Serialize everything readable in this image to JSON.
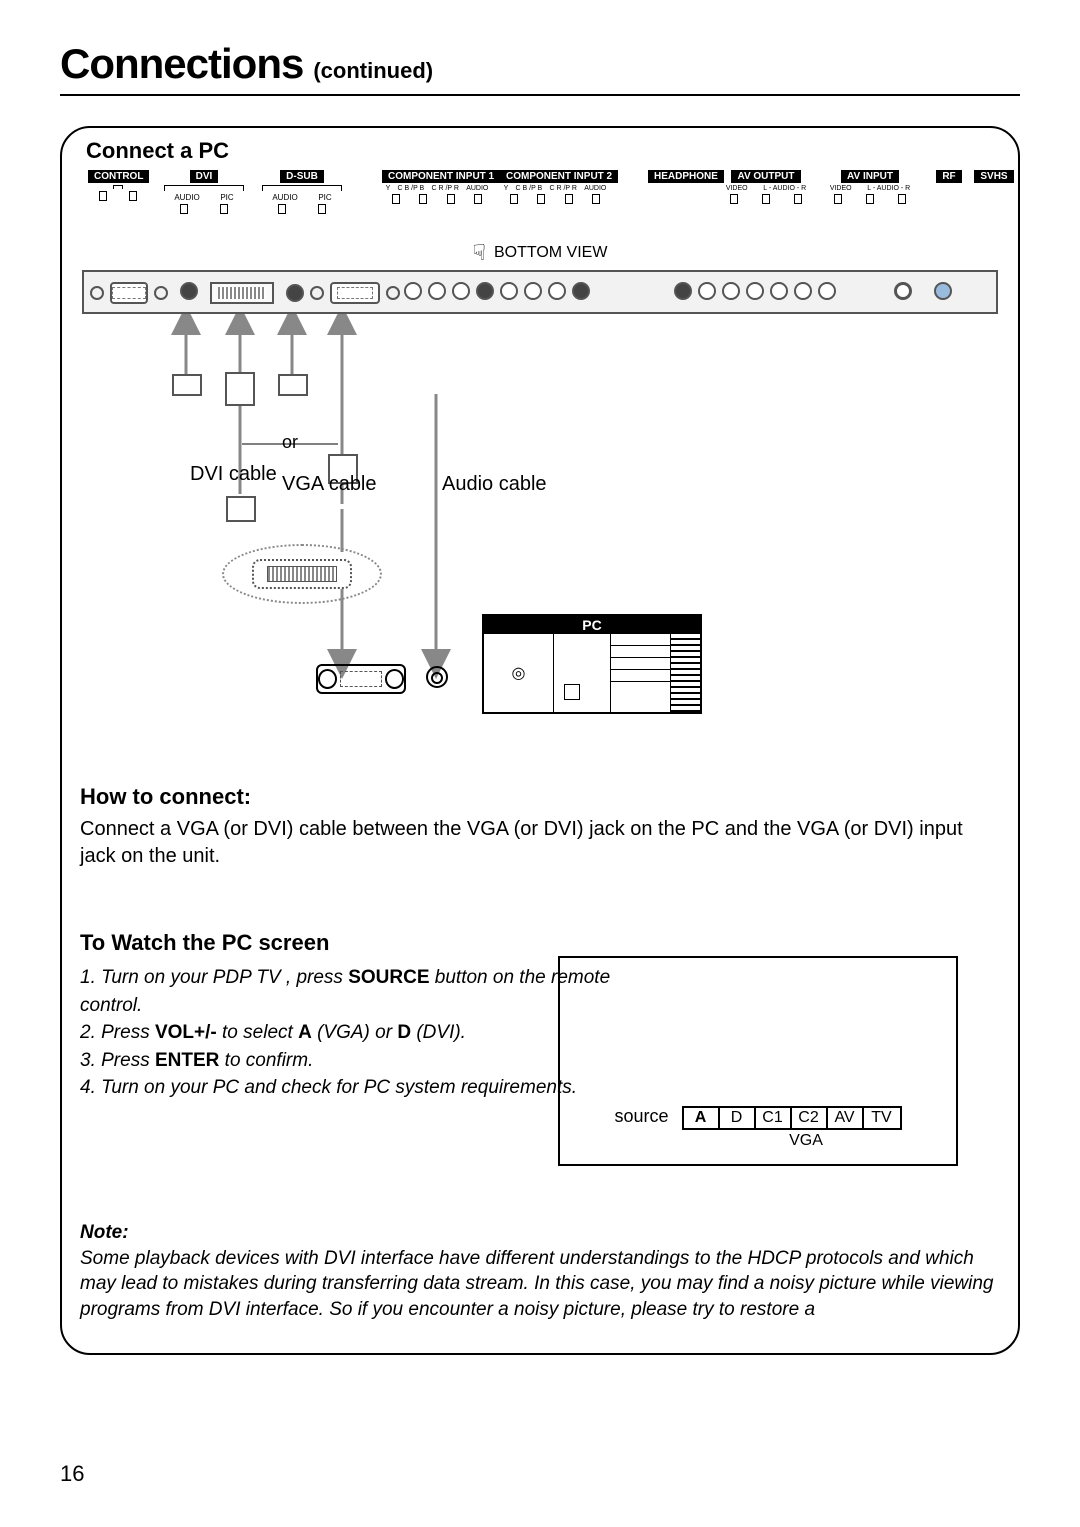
{
  "header": {
    "title": "Connections",
    "subtitle": "(continued)"
  },
  "panel": {
    "title": "Connect a PC",
    "ports": {
      "control": "CONTROL",
      "dvi": "DVI",
      "dvi_sub": [
        "AUDIO",
        "PIC"
      ],
      "dsub": "D-SUB",
      "dsub_sub": [
        "AUDIO",
        "PIC"
      ],
      "comp1": "COMPONENT INPUT 1",
      "comp1_sub": [
        "Y",
        "C B /P B",
        "C R /P R",
        "AUDIO"
      ],
      "comp2": "COMPONENT INPUT 2",
      "comp2_sub": [
        "Y",
        "C B /P B",
        "C R /P R",
        "AUDIO"
      ],
      "headphone": "HEADPHONE",
      "avout": "AV OUTPUT",
      "avout_sub": [
        "VIDEO",
        "L - AUDIO - R"
      ],
      "avin": "AV INPUT",
      "avin_sub": [
        "VIDEO",
        "L - AUDIO - R"
      ],
      "rf": "RF",
      "svhs": "SVHS"
    },
    "bottom_view": "BOTTOM VIEW",
    "cable_labels": {
      "dvi": "DVI cable",
      "vga": "VGA cable",
      "audio": "Audio cable",
      "or": "or",
      "pc": "PC"
    }
  },
  "howto": {
    "heading": "How to connect:",
    "text": "Connect a VGA (or DVI) cable between the VGA (or DVI) jack on the PC and the VGA (or DVI) input jack on the unit."
  },
  "watch": {
    "heading": "To Watch the PC screen",
    "s1a": "1. Turn on your PDP TV , press ",
    "s1b": "SOURCE",
    "s1c": " button on the remote control.",
    "s2a": "2. Press ",
    "s2b": "VOL+/-",
    "s2c": " to select ",
    "s2d": "A",
    "s2e": " (VGA) ",
    "s2f": "or ",
    "s2g": "D",
    "s2h": " (DVI).",
    "s3a": "3. Press ",
    "s3b": "ENTER",
    "s3c": " to confirm.",
    "s4": "4. Turn on your PC and check for PC system requirements."
  },
  "source_box": {
    "label": "source",
    "cells": [
      "A",
      "D",
      "C1",
      "C2",
      "AV",
      "TV"
    ],
    "selected_index": 0,
    "sub": "VGA"
  },
  "note": {
    "heading": "Note:",
    "text": "Some playback devices with DVI interface have different understandings to the HDCP protocols and which may lead to mistakes during transferring data stream. In this case, you may find a noisy picture while viewing programs from DVI interface. So if you encounter a noisy picture, please try to restore a"
  },
  "page_number": "16"
}
